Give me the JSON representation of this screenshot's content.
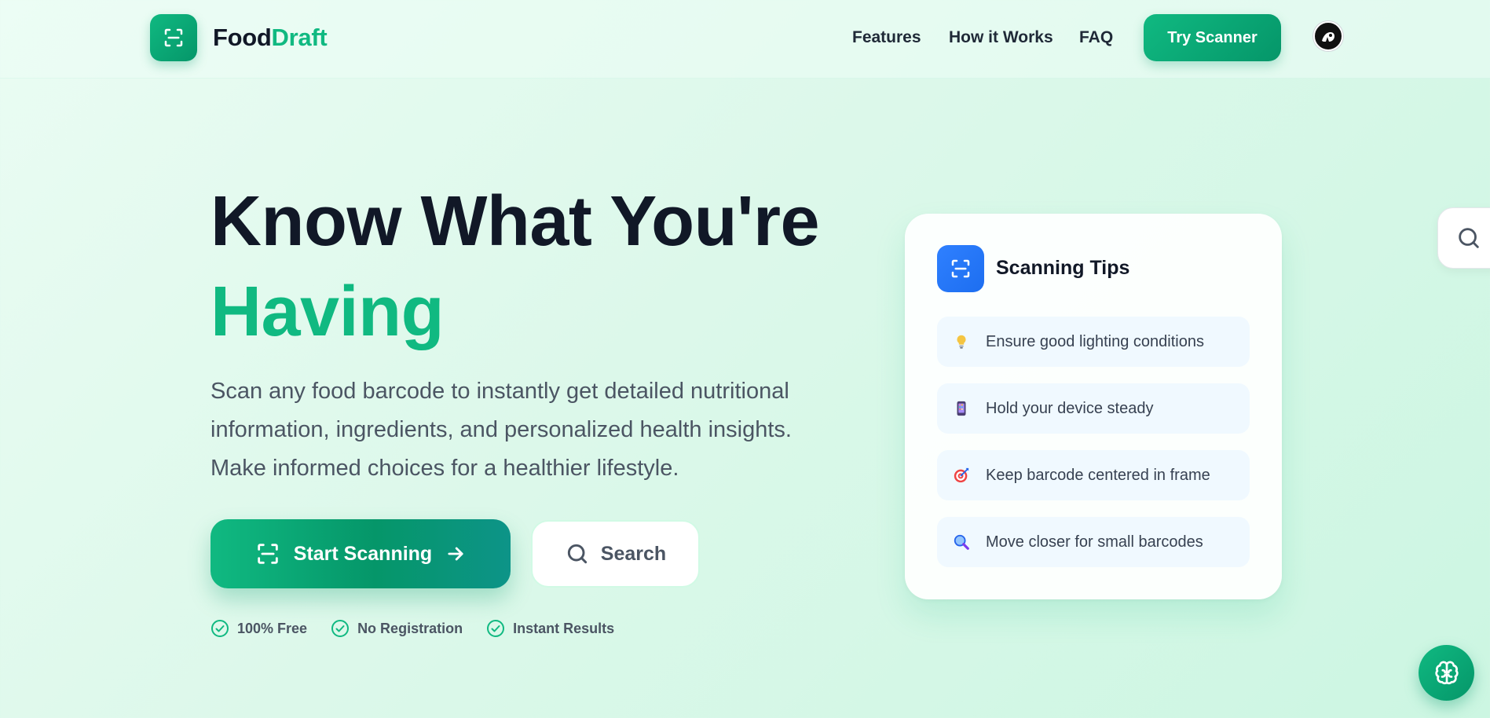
{
  "header": {
    "logo_part1": "Food",
    "logo_part2": "Draft",
    "logo_icon": "scan-icon",
    "nav": [
      "Features",
      "How it Works",
      "FAQ"
    ],
    "cta_label": "Try Scanner",
    "avatar_icon": "user-avatar"
  },
  "hero": {
    "title_line1": "Know What You're",
    "title_line2": "Having",
    "subtitle": "Scan any food barcode to instantly get detailed nutritional information, ingredients, and personalized health insights. Make informed choices for a healthier lifestyle.",
    "primary_button": "Start Scanning",
    "primary_icons": [
      "scan-icon",
      "arrow-right-icon"
    ],
    "secondary_button": "Search",
    "secondary_icon": "search-icon",
    "perks": [
      "100% Free",
      "No Registration",
      "Instant Results"
    ],
    "perk_icon": "check-circle-icon"
  },
  "tips": {
    "title": "Scanning Tips",
    "icon": "scan-icon",
    "items": [
      {
        "emoji": "💡",
        "text": "Ensure good lighting conditions"
      },
      {
        "emoji": "📱",
        "text": "Hold your device steady"
      },
      {
        "emoji": "🎯",
        "text": "Keep barcode centered in frame"
      },
      {
        "emoji": "🔍",
        "text": "Move closer for small barcodes"
      }
    ]
  },
  "floating": {
    "search_icon": "search-icon",
    "assistant_icon": "brain-icon"
  },
  "colors": {
    "accent": "#10b981",
    "accent_dark": "#059669",
    "tips_icon_bg": "#2f80ff",
    "heading": "#111827",
    "body_text": "#4b5563"
  }
}
